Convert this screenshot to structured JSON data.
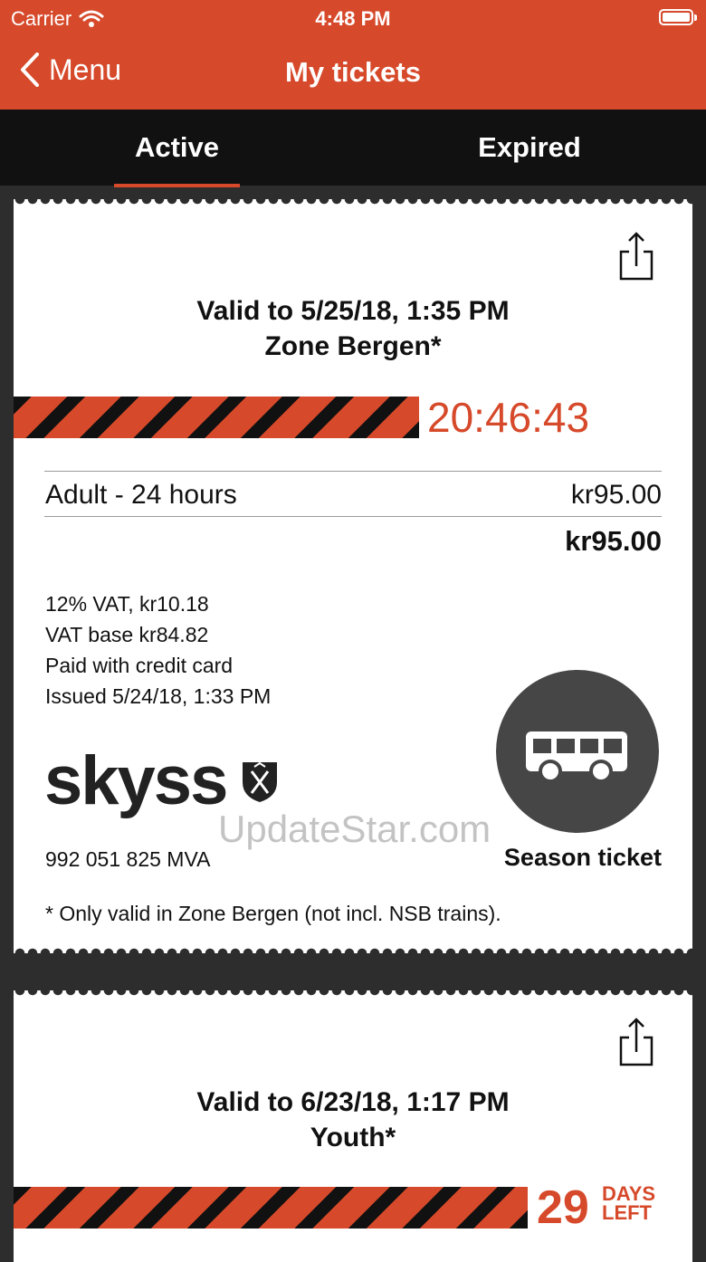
{
  "status_bar": {
    "carrier": "Carrier",
    "time": "4:48 PM"
  },
  "nav": {
    "back_label": "Menu",
    "title": "My tickets"
  },
  "tabs": [
    {
      "label": "Active",
      "active": true
    },
    {
      "label": "Expired",
      "active": false
    }
  ],
  "tickets": [
    {
      "valid_to": "Valid to 5/25/18, 1:35 PM",
      "zone": "Zone Bergen*",
      "countdown": "20:46:43",
      "item_name": "Adult - 24 hours",
      "item_price": "kr95.00",
      "total": "kr95.00",
      "info": [
        "12% VAT, kr10.18",
        "VAT base kr84.82",
        "Paid with credit card",
        "Issued 5/24/18, 1:33 PM"
      ],
      "brand": "skyss",
      "org_number": "992 051 825 MVA",
      "ticket_type": "Season ticket",
      "footnote": "* Only valid in Zone Bergen (not incl. NSB trains)."
    },
    {
      "valid_to": "Valid to 6/23/18, 1:17 PM",
      "zone": "Youth*",
      "days_count": "29",
      "days_line1": "DAYS",
      "days_line2": "LEFT"
    }
  ],
  "watermark": "UpdateStar.com",
  "colors": {
    "accent": "#d6492a",
    "dark": "#111111",
    "background": "#2d2d2d"
  }
}
